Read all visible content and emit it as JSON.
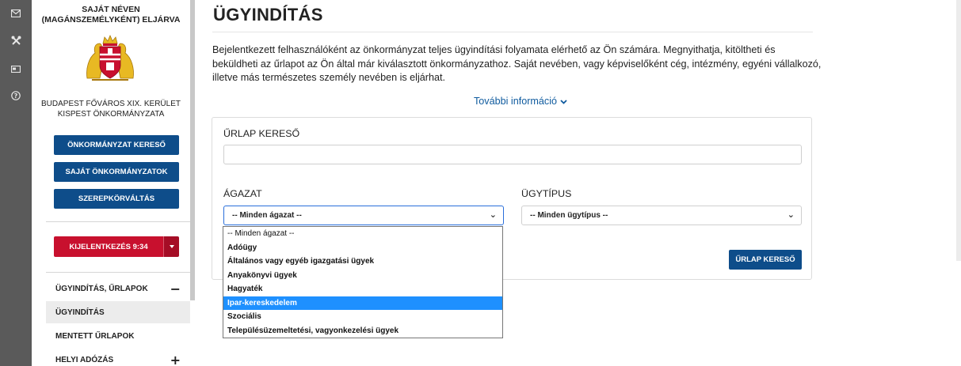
{
  "rail": {
    "icons": [
      "mail-icon",
      "tools-icon",
      "id-card-icon",
      "help-icon"
    ]
  },
  "sidebar": {
    "heading": "SAJÁT NÉVEN (MAGÁNSZEMÉLYKÉNT) ELJÁRVA",
    "org_name": "BUDAPEST FŐVÁROS XIX. KERÜLET KISPEST ÖNKORMÁNYZATA",
    "buttons": [
      "ÖNKORMÁNYZAT KERESŐ",
      "SAJÁT ÖNKORMÁNYZATOK",
      "SZEREPKÖRVÁLTÁS"
    ],
    "logout_label": "KIJELENTKEZÉS 9:34",
    "menu": {
      "section_label": "ÜGYINDÍTÁS, ŰRLAPOK",
      "section_sign": "−",
      "items": [
        "ÜGYINDÍTÁS",
        "MENTETT ŰRLAPOK"
      ],
      "next_section_label": "HELYI ADÓZÁS",
      "next_section_sign": "+"
    }
  },
  "main": {
    "title": "ÜGYINDÍTÁS",
    "intro": "Bejelentkezett felhasználóként az önkormányzat teljes ügyindítási folyamata elérhető az Ön számára. Megnyithatja, kitöltheti és beküldheti az űrlapot az Ön által már kiválasztott önkormányzathoz. Saját nevében, vagy képviselőként cég, intézmény, egyéni vállalkozó, illetve más természetes személy nevében is eljárhat.",
    "more_info": "További információ",
    "form": {
      "search_label": "ŰRLAP KERESŐ",
      "search_value": "",
      "sector_label": "ÁGAZAT",
      "sector_selected": "-- Minden ágazat --",
      "type_label": "ÜGYTÍPUS",
      "type_selected": "-- Minden ügytípus --",
      "search_button": "ŰRLAP KERESŐ"
    },
    "sector_options": [
      "-- Minden ágazat --",
      "Adóügy",
      "Általános vagy egyéb igazgatási ügyek",
      "Anyakönyvi ügyek",
      "Hagyaték",
      "Ipar-kereskedelem",
      "Szociális",
      "Településüzemeltetési, vagyonkezelési ügyek"
    ],
    "sector_highlighted_index": 5
  },
  "colors": {
    "primary": "#0e4d8a",
    "danger": "#c8102e",
    "highlight": "#1e90ff",
    "rail": "#5a5a5a",
    "link": "#0e5a9e"
  }
}
